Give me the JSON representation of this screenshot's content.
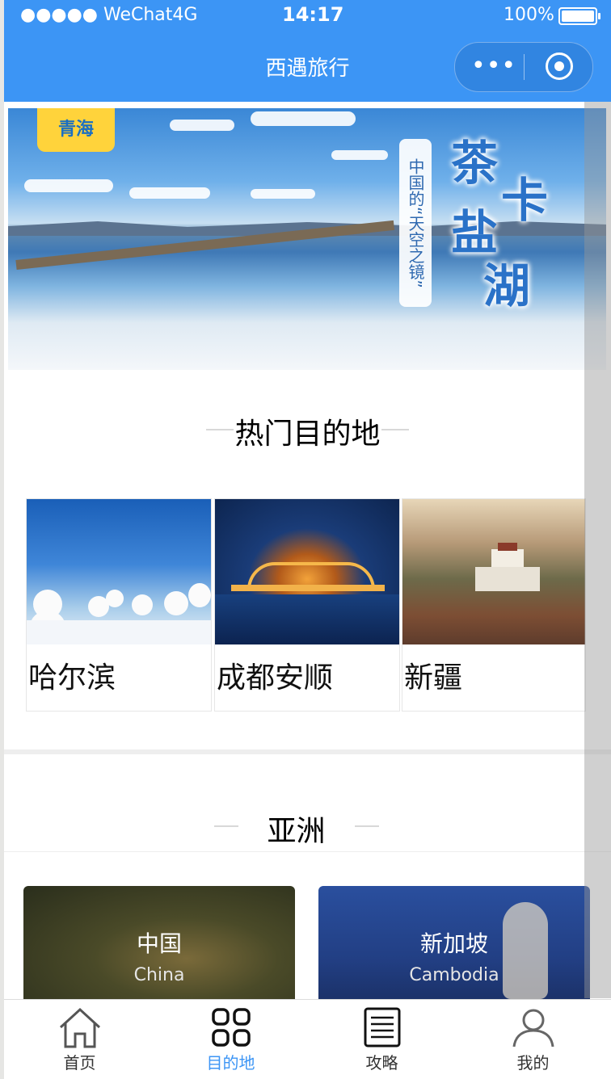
{
  "status_bar": {
    "signal": "●●●●● WeChat4G",
    "time": "14:17",
    "battery": "100%"
  },
  "nav": {
    "title": "西遇旅行",
    "more_icon": "more-dots-icon",
    "close_icon": "target-circle-icon"
  },
  "banner": {
    "tag": "青海",
    "subtitle": "中国的“天空之镜”",
    "title_chars": [
      "茶",
      "卡",
      "盐",
      "湖"
    ]
  },
  "hot": {
    "title": "热门目的地",
    "items": [
      {
        "name": "哈尔滨"
      },
      {
        "name": "成都安顺"
      },
      {
        "name": "新疆"
      }
    ]
  },
  "asia": {
    "title": "亚洲",
    "items": [
      {
        "name": "中国",
        "en": "China"
      },
      {
        "name": "新加坡",
        "en": "Cambodia"
      }
    ]
  },
  "tabbar": {
    "items": [
      {
        "label": "首页",
        "icon": "home-icon"
      },
      {
        "label": "目的地",
        "icon": "grid-icon"
      },
      {
        "label": "攻略",
        "icon": "document-icon"
      },
      {
        "label": "我的",
        "icon": "user-icon"
      }
    ],
    "active": "目的地",
    "active_color": "#3c95f5"
  },
  "colors": {
    "primary": "#3c95f5"
  }
}
